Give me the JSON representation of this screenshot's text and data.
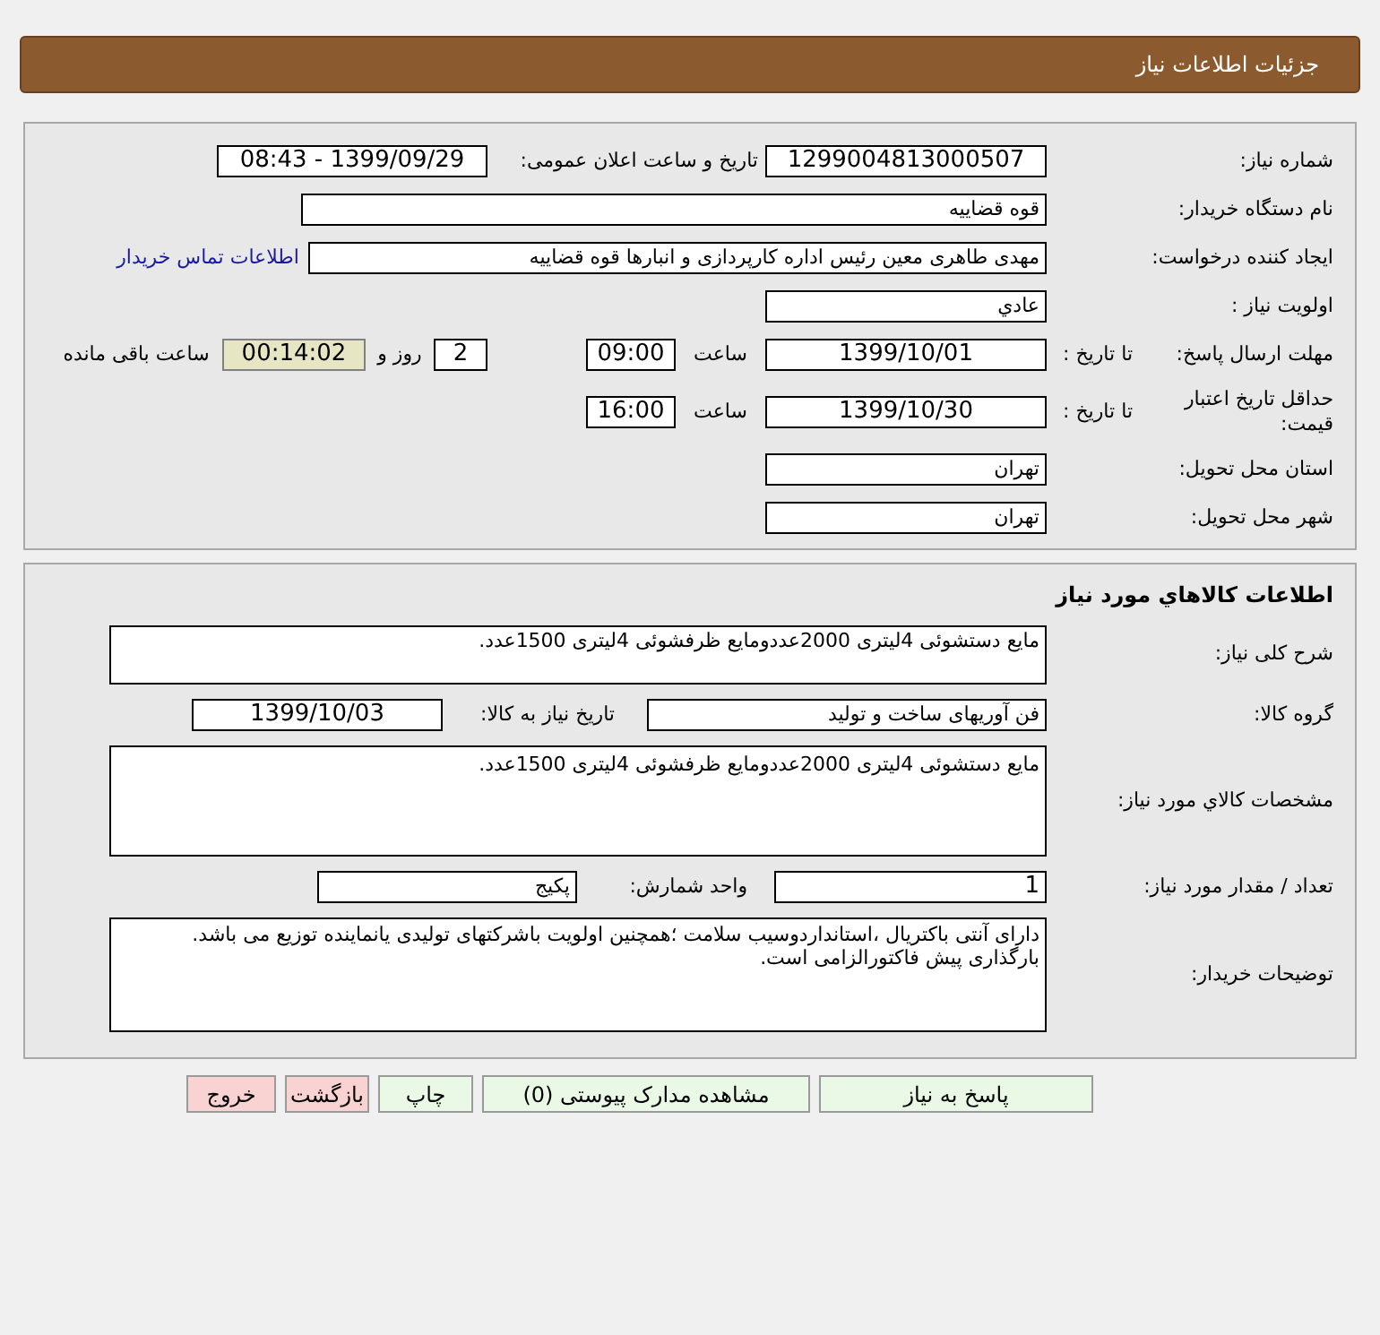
{
  "header": {
    "title": "جزئیات اطلاعات نیاز"
  },
  "need_info": {
    "need_number": {
      "label": "شماره نیاز:",
      "value": "1299004813000507"
    },
    "announce": {
      "label": "تاریخ و ساعت اعلان عمومی:",
      "value": "1399/09/29 - 08:43"
    },
    "buyer": {
      "label": "نام دستگاه خریدار:",
      "value": "قوه قضاییه"
    },
    "requester": {
      "label": "ایجاد کننده درخواست:",
      "value": "مهدی طاهری معین رئیس اداره کارپردازی و انبارها قوه قضاییه",
      "link": "اطلاعات تماس خریدار"
    },
    "priority": {
      "label": "اولویت نیاز :",
      "value": "عادي"
    },
    "deadline": {
      "label": "مهلت ارسال پاسخ:",
      "date_label": "تا تاریخ :",
      "date": "1399/10/01",
      "time_label": "ساعت",
      "time": "09:00",
      "days": "2",
      "days_label": "روز و",
      "remaining": "00:14:02",
      "remaining_label": "ساعت باقی مانده"
    },
    "price_validity": {
      "label": "حداقل تاریخ اعتبار قیمت:",
      "date_label": "تا تاریخ :",
      "date": "1399/10/30",
      "time_label": "ساعت",
      "time": "16:00"
    },
    "province": {
      "label": "استان محل تحویل:",
      "value": "تهران"
    },
    "city": {
      "label": "شهر محل تحویل:",
      "value": "تهران"
    }
  },
  "goods": {
    "title": "اطلاعات کالاهاي مورد نیاز",
    "description": {
      "label": "شرح کلی نیاز:",
      "value": "مایع دستشوئی 4لیتری 2000عددومایع ظرفشوئی 4لیتری 1500عدد."
    },
    "group": {
      "label": "گروه کالا:",
      "value": "فن آوریهای ساخت و تولید",
      "date_label": "تاریخ نیاز به کالا:",
      "date": "1399/10/03"
    },
    "specs": {
      "label": "مشخصات کالاي مورد نیاز:",
      "value": "مایع دستشوئی 4لیتری 2000عددومایع ظرفشوئی 4لیتری 1500عدد."
    },
    "quantity": {
      "label": "تعداد / مقدار مورد نیاز:",
      "value": "1",
      "unit_label": "واحد شمارش:",
      "unit": "پکیج"
    },
    "buyer_notes": {
      "label": "توضیحات خریدار:",
      "lines": [
        "دارای آنتی باکتریال ،استانداردوسیب سلامت ؛همچنین اولویت باشرکتهای تولیدی یانماینده توزیع می باشد.",
        "بارگذاری پیش فاکتورالزامی است."
      ]
    }
  },
  "buttons": [
    {
      "label": "پاسخ به نیاز",
      "kind": "primary"
    },
    {
      "label": "مشاهده مدارک پیوستی (0)",
      "kind": "primary"
    },
    {
      "label": "چاپ",
      "kind": "primary"
    },
    {
      "label": "بازگشت",
      "kind": "danger"
    },
    {
      "label": "خروج",
      "kind": "danger"
    }
  ]
}
